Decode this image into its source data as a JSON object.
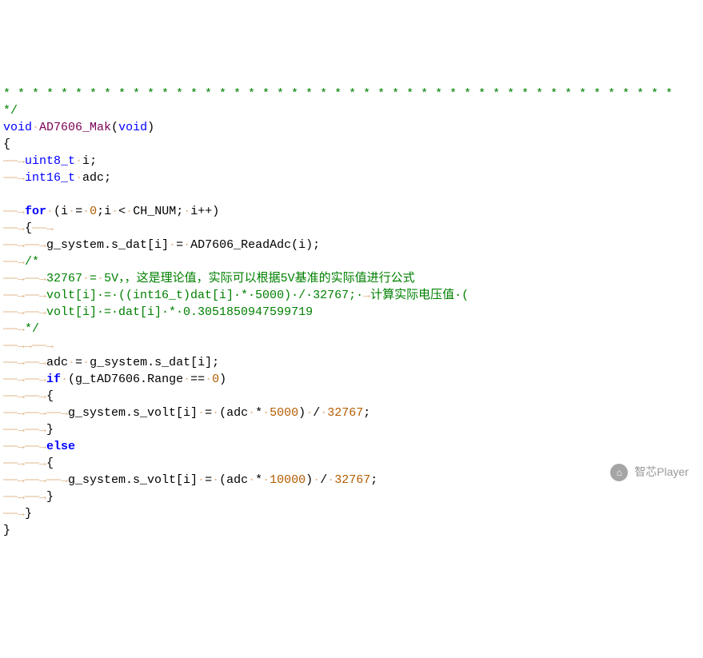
{
  "code": {
    "line_stars": "* * * * * * * * * * * * * * * * * * * * * * * * * * * * * * * * * * * * * * * * * * * * * * *",
    "close_block": "*/",
    "ret_type": "void",
    "func_name": "AD7606_Mak",
    "param_void": "void",
    "decl_u8": "uint8_t",
    "decl_i": "i",
    "decl_i16": "int16_t",
    "decl_adc": "adc",
    "for_kw": "for",
    "for_cond_a": "(i",
    "for_cond_eq": "=",
    "for_zero": "0",
    "for_semi": ";i",
    "for_lt": "<",
    "for_chnum": "CH_NUM;",
    "for_inc": "i++)",
    "brace_open": "{",
    "brace_close": "}",
    "gsys": "g_system.s_dat[i]",
    "assign": "=",
    "readadc": "AD7606_ReadAdc(i);",
    "cmt_open": "/*",
    "cmt_l1_a": "32767",
    "cmt_l1_b": "=",
    "cmt_l1_c": "5V，，这是理论值，实际可以根据5V基准的实际值进行公式",
    "cmt_l2": "volt[i]·=·((int16_t)dat[i]·*·5000)·/·32767;·",
    "cmt_l2_tail": "计算实际电压值·(",
    "cmt_l3": "volt[i]·=·dat[i]·*·0.3051850947599719",
    "cmt_close": "*/",
    "adc_assign_l": "adc",
    "adc_assign_r": "g_system.s_dat[i];",
    "if_kw": "if",
    "if_cond": "(g_tAD7606.Range",
    "eqeq": "==",
    "zero": "0",
    "if_close": ")",
    "volt_l": "g_system.s_volt[i]",
    "adc_expr": "(adc",
    "star": "*",
    "n5000": "5000",
    "paren_close": ")",
    "slash": "/",
    "n32767": "32767",
    "semi": ";",
    "else_kw": "else",
    "n10000": "10000"
  },
  "watermark": {
    "text": "智芯Player",
    "icon_glyph": "⌂"
  }
}
